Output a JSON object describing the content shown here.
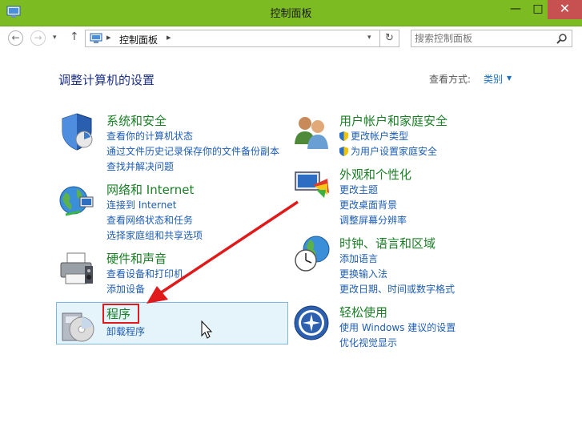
{
  "window": {
    "title": "控制面板",
    "minimize": "—",
    "maximize": "□",
    "close": "✕"
  },
  "addressbar": {
    "back": "←",
    "forward": "→",
    "recent": "▾",
    "up": "↑",
    "separator": "▸",
    "crumb": "控制面板",
    "dropdown": "▾",
    "refresh": "↻",
    "search_placeholder": "搜索控制面板"
  },
  "header": {
    "page_title": "调整计算机的设置",
    "view_label": "查看方式:",
    "view_value": "类别",
    "view_arrow": "▼"
  },
  "categories": {
    "system": {
      "title": "系统和安全",
      "links": [
        "查看你的计算机状态",
        "通过文件历史记录保存你的文件备份副本",
        "查找并解决问题"
      ]
    },
    "network": {
      "title": "网络和 Internet",
      "links": [
        "连接到 Internet",
        "查看网络状态和任务",
        "选择家庭组和共享选项"
      ]
    },
    "hardware": {
      "title": "硬件和声音",
      "links": [
        "查看设备和打印机",
        "添加设备"
      ]
    },
    "programs": {
      "title": "程序",
      "links": [
        "卸载程序"
      ]
    },
    "accounts": {
      "title": "用户帐户和家庭安全",
      "links": [
        "更改帐户类型",
        "为用户设置家庭安全"
      ]
    },
    "appearance": {
      "title": "外观和个性化",
      "links": [
        "更改主题",
        "更改桌面背景",
        "调整屏幕分辨率"
      ]
    },
    "clock": {
      "title": "时钟、语言和区域",
      "links": [
        "添加语言",
        "更换输入法",
        "更改日期、时间或数字格式"
      ]
    },
    "ease": {
      "title": "轻松使用",
      "links": [
        "使用 Windows 建议的设置",
        "优化视觉显示"
      ]
    }
  },
  "colors": {
    "titlebar": "#7dbb22",
    "category_title": "#1a7f25",
    "link": "#1e5db5",
    "annotation": "#e01a1a",
    "selection": "#e5f3fb"
  }
}
